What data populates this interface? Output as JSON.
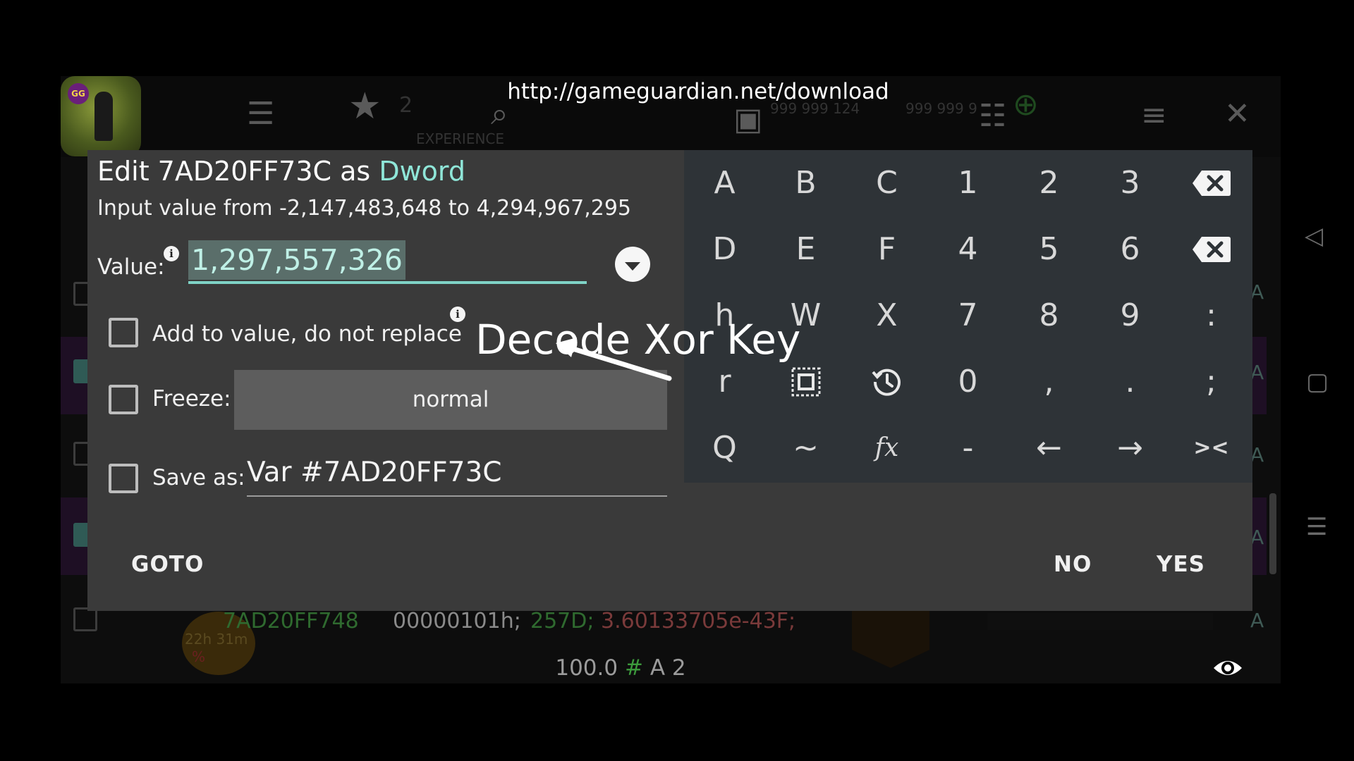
{
  "overlay": {
    "url": "http://gameguardian.net/download",
    "annotation": "Decode Xor Key"
  },
  "background": {
    "top_counter": "2",
    "experience_label": "EXPERIENCE",
    "coins_left": "999 999 124",
    "coins_right": "999 999 9",
    "row": {
      "address": "7AD20FF748",
      "hex_value": "00000101h;",
      "dec_value": "257D;",
      "float_value": "3.60133705e-43F;",
      "timer": "22h 31m",
      "percent": "%"
    },
    "row_type_label": "A",
    "status": {
      "speed": "100.0",
      "hash": "#",
      "region": "A",
      "count": "2"
    }
  },
  "dialog": {
    "title_prefix": "Edit 7AD20FF73C as",
    "title_type": "Dword",
    "range": "Input value from -2,147,483,648 to 4,294,967,295",
    "value_label": "Value:",
    "info_glyph": "i",
    "value": "1,297,557,326",
    "add_to_value_label": "Add to value, do not replace",
    "freeze_label": "Freeze:",
    "freeze_mode": "normal",
    "save_as_label": "Save as:",
    "save_as_value": "Var #7AD20FF73C",
    "goto_label": "GOTO",
    "no_label": "NO",
    "yes_label": "YES"
  },
  "keyboard": {
    "rows": [
      [
        "A",
        "B",
        "C",
        "1",
        "2",
        "3"
      ],
      [
        "D",
        "E",
        "F",
        "4",
        "5",
        "6"
      ],
      [
        "h",
        "W",
        "X",
        "7",
        "8",
        "9",
        ":"
      ],
      [
        "r",
        "",
        "",
        "0",
        ",",
        ".",
        ";"
      ],
      [
        "Q",
        "~",
        "fx",
        "-",
        "←",
        "→",
        "><"
      ]
    ]
  },
  "colors": {
    "accent": "#8fe6d8",
    "dialog_bg": "#3a3a3a",
    "keyboard_bg": "#2e3337"
  }
}
